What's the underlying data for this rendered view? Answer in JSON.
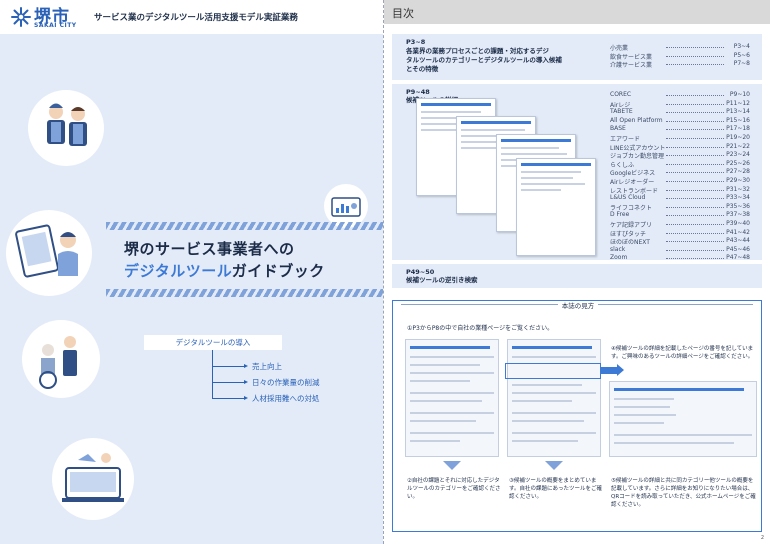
{
  "header": {
    "logo_text": "堺市",
    "logo_sub": "SAKAI CITY",
    "doc_title": "サービス業のデジタルツール活用支援モデル実証業務"
  },
  "cover": {
    "title_line1": "堺のサービス事業者への",
    "title_line2_accent": "デジタルツール",
    "title_line2_rest": "ガイドブック",
    "intro_label": "デジタルツールの導入",
    "benefits": [
      "売上向上",
      "日々の作業量の削減",
      "人材採用難への対処"
    ]
  },
  "toc": {
    "title": "目次",
    "section1": {
      "pages": "P3~8",
      "lines": [
        "各業界の業務プロセスごとの課題・対応するデジ",
        "タルツールのカテゴリーとデジタルツールの導入候補",
        "とその特徴"
      ],
      "items": [
        {
          "name": "小売業",
          "page": "P3~4"
        },
        {
          "name": "飲食サービス業",
          "page": "P5~6"
        },
        {
          "name": "介護サービス業",
          "page": "P7~8"
        }
      ]
    },
    "section2": {
      "pages": "P9~48",
      "label": "候補ツールの詳細",
      "items": [
        {
          "name": "COREC",
          "page": "P9~10"
        },
        {
          "name": "Airレジ",
          "page": "P11~12"
        },
        {
          "name": "TABETE",
          "page": "P13~14"
        },
        {
          "name": "All Open Platform",
          "page": "P15~16"
        },
        {
          "name": "BASE",
          "page": "P17~18"
        },
        {
          "name": "エアワード",
          "page": "P19~20"
        },
        {
          "name": "LINE公式アカウント",
          "page": "P21~22"
        },
        {
          "name": "ジョブカン勤怠管理",
          "page": "P23~24"
        },
        {
          "name": "らくしふ",
          "page": "P25~26"
        },
        {
          "name": "Googleビジネス",
          "page": "P27~28"
        },
        {
          "name": "Airレジオーダー",
          "page": "P29~30"
        },
        {
          "name": "レストランボード",
          "page": "P31~32"
        },
        {
          "name": "L&US Cloud",
          "page": "P33~34"
        },
        {
          "name": "ライフコネクト",
          "page": "P35~36"
        },
        {
          "name": "D Free",
          "page": "P37~38"
        },
        {
          "name": "ケア記録アプリ",
          "page": "P39~40"
        },
        {
          "name": "ほすぴタッチ",
          "page": "P41~42"
        },
        {
          "name": "ほのぼのNEXT",
          "page": "P43~44"
        },
        {
          "name": "slack",
          "page": "P45~46"
        },
        {
          "name": "Zoom",
          "page": "P47~48"
        }
      ]
    },
    "section3": {
      "pages": "P49~50",
      "label": "候補ツールの逆引き検索"
    }
  },
  "how_to": {
    "title": "本誌の見方",
    "step1": "①P3からP8の中で自社の業種ページをご覧ください。",
    "step2": "②自社の課題とそれに対応したデジタルツールのカテゴリーをご確認ください。",
    "step3": "③候補ツールの概要をまとめています。自社の課題にあったツールをご確認ください。",
    "step4": "④候補ツールの詳細を記載したページの番号を記しています。ご興味のあるツールの詳細ページをご確認ください。",
    "step5": "⑤候補ツールの詳細と共に同カテゴリー他ツールの概要を記載しています。さらに詳細をお知りになりたい場合は、QRコードを読み取っていただき、公式ホームページをご確認ください。"
  },
  "page_number": "2"
}
